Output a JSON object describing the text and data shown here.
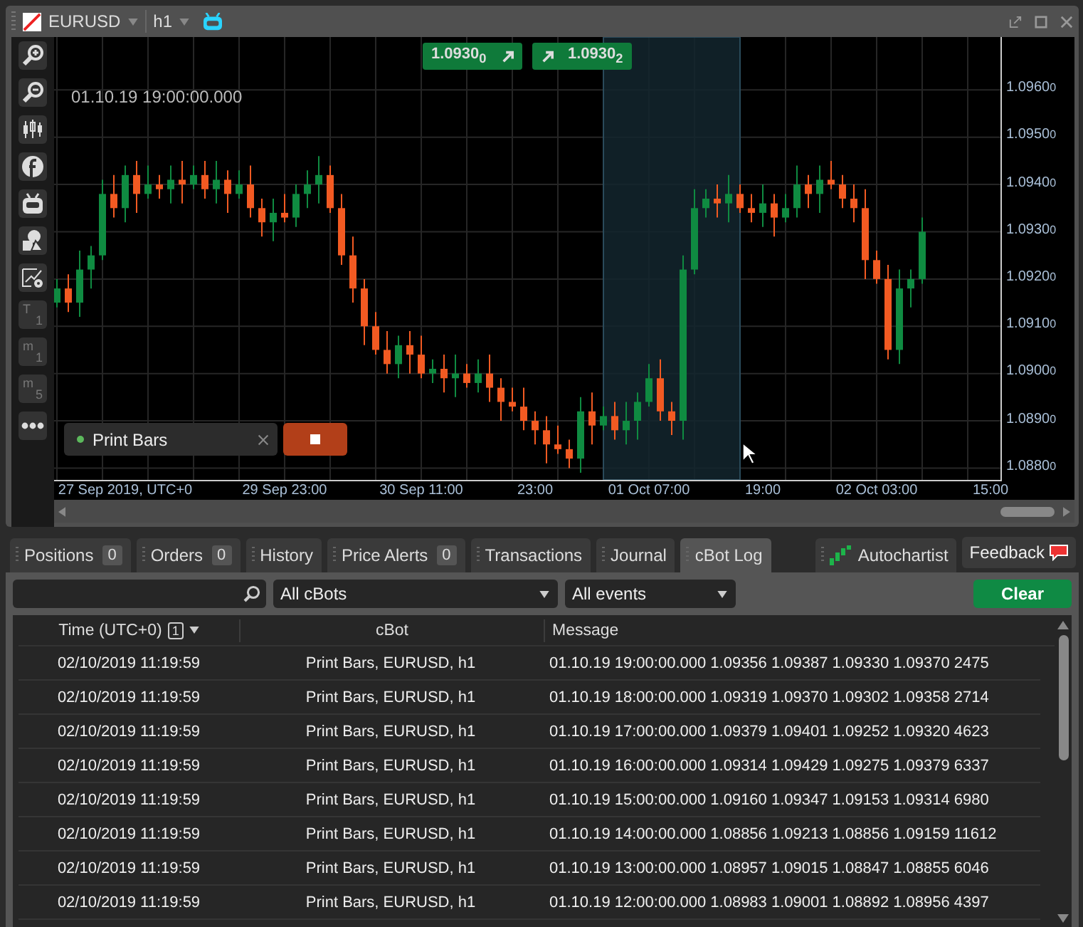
{
  "chart_window": {
    "symbol": "EURUSD",
    "timeframe": "h1",
    "side_tools": [
      {
        "kind": "icon"
      },
      {
        "kind": "icon"
      },
      {
        "kind": "icon"
      },
      {
        "kind": "icon"
      },
      {
        "kind": "icon"
      },
      {
        "kind": "icon"
      },
      {
        "kind": "icon"
      },
      {
        "kind": "text",
        "letter": "T",
        "number": "1"
      },
      {
        "kind": "text",
        "letter": "m",
        "number": "1"
      },
      {
        "kind": "text",
        "letter": "m",
        "number": "5"
      },
      {
        "kind": "icon"
      }
    ],
    "sell_price": "1.0930$_{0}$",
    "buy_price": "1.0930$_{2}$",
    "crosshair_time": "01.10.19 19:00:00.000",
    "chart_data": {
      "type": "candlestick",
      "grid": true,
      "categories": [
        null,
        null,
        null,
        null,
        null,
        null,
        "27 Sep 2019, UTC+0",
        null,
        null,
        null,
        null,
        null,
        null,
        null,
        null,
        null,
        null,
        null,
        null,
        null,
        "29 Sep 23:00",
        null,
        null,
        null,
        null,
        null,
        null,
        null,
        null,
        null,
        null,
        null,
        "30 Sep 11:00",
        null,
        null,
        null,
        null,
        null,
        null,
        null,
        null,
        null,
        "23:00",
        null,
        null,
        null,
        null,
        null,
        null,
        null,
        null,
        null,
        "01 Oct 07:00",
        null,
        null,
        null,
        null,
        null,
        null,
        null,
        null,
        null,
        "19:00",
        null,
        null,
        null,
        null,
        null,
        null,
        null,
        null,
        null,
        "02 Oct 03:00",
        null,
        null,
        null,
        null,
        null,
        null,
        null,
        null,
        null,
        "15:00"
      ],
      "ohlc": [
        [
          1.0915,
          1.092,
          1.0914,
          1.0918
        ],
        [
          1.0918,
          1.0921,
          1.0913,
          1.0915
        ],
        [
          1.0915,
          1.0926,
          1.0912,
          1.0922
        ],
        [
          1.0922,
          1.0927,
          1.0918,
          1.0925
        ],
        [
          1.0925,
          1.0941,
          1.0924,
          1.0938
        ],
        [
          1.0938,
          1.0942,
          1.0933,
          1.0935
        ],
        [
          1.0935,
          1.0944,
          1.0932,
          1.0942
        ],
        [
          1.0942,
          1.0945,
          1.0934,
          1.0938
        ],
        [
          1.0938,
          1.0944,
          1.0937,
          1.094
        ],
        [
          1.094,
          1.0942,
          1.0937,
          1.0939
        ],
        [
          1.0939,
          1.0944,
          1.0936,
          1.0941
        ],
        [
          1.0941,
          1.0945,
          1.0936,
          1.094
        ],
        [
          1.094,
          1.0944,
          1.0939,
          1.0942
        ],
        [
          1.0942,
          1.0945,
          1.0937,
          1.0939
        ],
        [
          1.0939,
          1.0945,
          1.0936,
          1.0941
        ],
        [
          1.0941,
          1.0943,
          1.0934,
          1.0938
        ],
        [
          1.0938,
          1.0943,
          1.0937,
          1.094
        ],
        [
          1.094,
          1.0944,
          1.0933,
          1.0935
        ],
        [
          1.0935,
          1.0937,
          1.0929,
          1.0932
        ],
        [
          1.0932,
          1.0937,
          1.0928,
          1.0934
        ],
        [
          1.0934,
          1.0938,
          1.0932,
          1.0933
        ],
        [
          1.0933,
          1.094,
          1.0931,
          1.0938
        ],
        [
          1.0938,
          1.0943,
          1.0935,
          1.094
        ],
        [
          1.094,
          1.0946,
          1.0936,
          1.0942
        ],
        [
          1.0942,
          1.0944,
          1.0934,
          1.0935
        ],
        [
          1.0935,
          1.0938,
          1.0923,
          1.0925
        ],
        [
          1.0925,
          1.0929,
          1.0915,
          1.0918
        ],
        [
          1.0918,
          1.092,
          1.0906,
          1.091
        ],
        [
          1.091,
          1.0913,
          1.0904,
          1.0905
        ],
        [
          1.0905,
          1.0909,
          1.09,
          1.0902
        ],
        [
          1.0902,
          1.0908,
          1.0899,
          1.0906
        ],
        [
          1.0906,
          1.0909,
          1.09,
          1.0904
        ],
        [
          1.0904,
          1.0908,
          1.0899,
          1.09
        ],
        [
          1.09,
          1.0903,
          1.0898,
          1.0901
        ],
        [
          1.0901,
          1.0904,
          1.0896,
          1.0899
        ],
        [
          1.0899,
          1.0904,
          1.0895,
          1.09
        ],
        [
          1.09,
          1.0902,
          1.0897,
          1.0898
        ],
        [
          1.0898,
          1.0903,
          1.0896,
          1.09
        ],
        [
          1.09,
          1.0904,
          1.0894,
          1.0897
        ],
        [
          1.0897,
          1.0899,
          1.089,
          1.0894
        ],
        [
          1.0894,
          1.0897,
          1.0892,
          1.0893
        ],
        [
          1.0893,
          1.0897,
          1.0888,
          1.089
        ],
        [
          1.089,
          1.0892,
          1.0885,
          1.0888
        ],
        [
          1.0888,
          1.0891,
          1.0881,
          1.0885
        ],
        [
          1.0885,
          1.0889,
          1.0883,
          1.0884
        ],
        [
          1.0884,
          1.0886,
          1.088,
          1.0882
        ],
        [
          1.0882,
          1.0895,
          1.0879,
          1.0892
        ],
        [
          1.0892,
          1.0896,
          1.0885,
          1.0889
        ],
        [
          1.0889,
          1.0893,
          1.0888,
          1.0891
        ],
        [
          1.0891,
          1.0894,
          1.0886,
          1.0888
        ],
        [
          1.0888,
          1.0894,
          1.0885,
          1.089
        ],
        [
          1.089,
          1.0896,
          1.0886,
          1.0894
        ],
        [
          1.0894,
          1.0902,
          1.0893,
          1.0899
        ],
        [
          1.0899,
          1.0903,
          1.089,
          1.0892
        ],
        [
          1.0892,
          1.0894,
          1.0887,
          1.089
        ],
        [
          1.089,
          1.0925,
          1.0886,
          1.0922
        ],
        [
          1.0922,
          1.0939,
          1.0921,
          1.0935
        ],
        [
          1.0935,
          1.0939,
          1.0933,
          1.0937
        ],
        [
          1.0937,
          1.094,
          1.0933,
          1.0936
        ],
        [
          1.0936,
          1.0942,
          1.0932,
          1.0938
        ],
        [
          1.0938,
          1.094,
          1.0934,
          1.0935
        ],
        [
          1.0935,
          1.0938,
          1.0932,
          1.0934
        ],
        [
          1.0934,
          1.094,
          1.0931,
          1.0936
        ],
        [
          1.0936,
          1.0938,
          1.0929,
          1.0933
        ],
        [
          1.0933,
          1.0938,
          1.0932,
          1.0935
        ],
        [
          1.0935,
          1.0944,
          1.0933,
          1.094
        ],
        [
          1.094,
          1.0942,
          1.0935,
          1.0938
        ],
        [
          1.0938,
          1.0944,
          1.0934,
          1.0941
        ],
        [
          1.0941,
          1.0945,
          1.0939,
          1.094
        ],
        [
          1.094,
          1.0942,
          1.0935,
          1.0937
        ],
        [
          1.0937,
          1.094,
          1.0932,
          1.0935
        ],
        [
          1.0935,
          1.0939,
          1.092,
          1.0924
        ],
        [
          1.0924,
          1.0926,
          1.0919,
          1.092
        ],
        [
          1.092,
          1.0923,
          1.0903,
          1.0905
        ],
        [
          1.0905,
          1.0922,
          1.0902,
          1.0918
        ],
        [
          1.0918,
          1.0922,
          1.0914,
          1.092
        ],
        [
          1.092,
          1.0933,
          1.0919,
          1.093
        ],
        null,
        null,
        null,
        null,
        null,
        null
      ],
      "ylim": [
        1.08775,
        1.09712
      ],
      "yticks": [
        {
          "value": 1.096,
          "label": "1.09600"
        },
        {
          "value": 1.095,
          "label": "1.09500"
        },
        {
          "value": 1.094,
          "label": "1.09400"
        },
        {
          "value": 1.093,
          "label": "1.09300"
        },
        {
          "value": 1.092,
          "label": "1.09200"
        },
        {
          "value": 1.091,
          "label": "1.09100"
        },
        {
          "value": 1.09,
          "label": "1.09000"
        },
        {
          "value": 1.089,
          "label": "1.08900"
        },
        {
          "value": 1.088,
          "label": "1.08800"
        }
      ]
    },
    "bot": {
      "name": "Print Bars",
      "running": true
    }
  },
  "tabs": [
    {
      "label": "Positions",
      "count": "0",
      "selected": false
    },
    {
      "label": "Orders",
      "count": "0",
      "selected": false
    },
    {
      "label": "History",
      "selected": false
    },
    {
      "label": "Price Alerts",
      "count": "0",
      "selected": false
    },
    {
      "label": "Transactions",
      "selected": false
    },
    {
      "label": "Journal",
      "selected": false
    },
    {
      "label": "cBot Log",
      "selected": true
    }
  ],
  "autochartist": "Autochartist",
  "feedback": "Feedback",
  "filters": {
    "cbot": "All cBots",
    "events": "All events",
    "clear": "Clear"
  },
  "table": {
    "columns": [
      {
        "label": "Time (UTC+0)",
        "sort_badge": "1"
      },
      {
        "label": "cBot"
      },
      {
        "label": "Message"
      }
    ],
    "rows": [
      {
        "time": "02/10/2019 11:19:59",
        "cbot": "Print Bars, EURUSD, h1",
        "message": "01.10.19 19:00:00.000 1.09356 1.09387 1.09330 1.09370 2475"
      },
      {
        "time": "02/10/2019 11:19:59",
        "cbot": "Print Bars, EURUSD, h1",
        "message": "01.10.19 18:00:00.000 1.09319 1.09370 1.09302 1.09358 2714"
      },
      {
        "time": "02/10/2019 11:19:59",
        "cbot": "Print Bars, EURUSD, h1",
        "message": "01.10.19 17:00:00.000 1.09379 1.09401 1.09252 1.09320 4623"
      },
      {
        "time": "02/10/2019 11:19:59",
        "cbot": "Print Bars, EURUSD, h1",
        "message": "01.10.19 16:00:00.000 1.09314 1.09429 1.09275 1.09379 6337"
      },
      {
        "time": "02/10/2019 11:19:59",
        "cbot": "Print Bars, EURUSD, h1",
        "message": "01.10.19 15:00:00.000 1.09160 1.09347 1.09153 1.09314 6980"
      },
      {
        "time": "02/10/2019 11:19:59",
        "cbot": "Print Bars, EURUSD, h1",
        "message": "01.10.19 14:00:00.000 1.08856 1.09213 1.08856 1.09159 11612"
      },
      {
        "time": "02/10/2019 11:19:59",
        "cbot": "Print Bars, EURUSD, h1",
        "message": "01.10.19 13:00:00.000 1.08957 1.09015 1.08847 1.08855 6046"
      },
      {
        "time": "02/10/2019 11:19:59",
        "cbot": "Print Bars, EURUSD, h1",
        "message": "01.10.19 12:00:00.000 1.08983 1.09001 1.08892 1.08956 4397"
      }
    ]
  }
}
